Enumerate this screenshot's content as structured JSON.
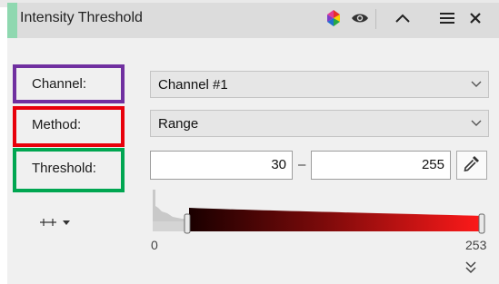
{
  "panel": {
    "title": "Intensity Threshold",
    "header_icons": [
      "color-wheel-icon",
      "eye-icon",
      "chevron-up-icon",
      "menu-icon",
      "close-icon"
    ]
  },
  "rows": {
    "channel": {
      "label": "Channel:",
      "value": "Channel #1"
    },
    "method": {
      "label": "Method:",
      "value": "Range"
    },
    "threshold": {
      "label": "Threshold:",
      "low": "30",
      "separator": "–",
      "high": "255"
    }
  },
  "histogram": {
    "min_label": "0",
    "max_label": "253",
    "low_handle": 30,
    "high_handle": 255,
    "scale_max": 255
  },
  "colors": {
    "accent": "#8fd8b0",
    "channel_outline": "#7030a0",
    "method_outline": "#e8000b",
    "threshold_outline": "#00a651",
    "ramp_start": "#1a0000",
    "ramp_end": "#ff1a1a"
  },
  "icons": {
    "histogram_options": "range-adjust-icon",
    "expand": "double-chevron-down-icon",
    "picker": "eyedropper-icon"
  }
}
